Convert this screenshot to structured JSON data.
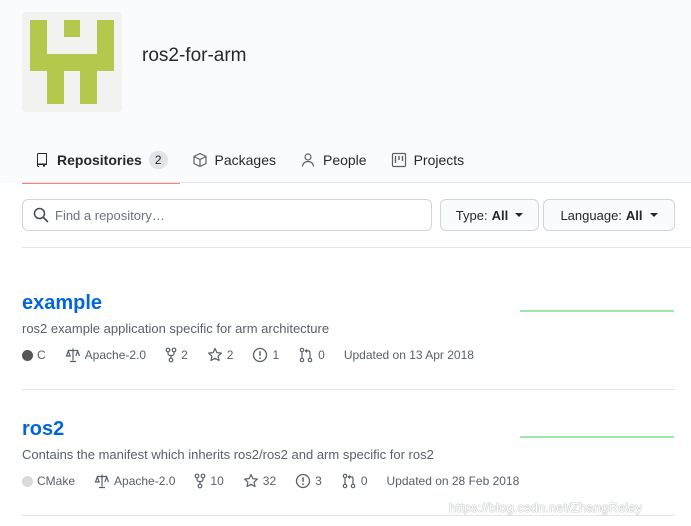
{
  "org": {
    "name": "ros2-for-arm",
    "avatar_color": "#b5c84e"
  },
  "tabs": [
    {
      "label": "Repositories",
      "count": "2",
      "icon": "repo-icon",
      "selected": true
    },
    {
      "label": "Packages",
      "icon": "package-icon"
    },
    {
      "label": "People",
      "icon": "person-icon"
    },
    {
      "label": "Projects",
      "icon": "project-icon"
    }
  ],
  "search": {
    "placeholder": "Find a repository…",
    "value": ""
  },
  "filters": {
    "type_label": "Type:",
    "type_value": "All",
    "language_label": "Language:",
    "language_value": "All"
  },
  "repos": [
    {
      "name": "example",
      "description": "ros2 example application specific for arm architecture",
      "language": "C",
      "language_color": "#555555",
      "license": "Apache-2.0",
      "forks": "2",
      "stars": "2",
      "issues": "1",
      "pull_requests": "0",
      "updated": "Updated on 13 Apr 2018"
    },
    {
      "name": "ros2",
      "description": "Contains the manifest which inherits ros2/ros2 and arm specific for ros2",
      "language": "CMake",
      "language_color": "#dadada",
      "license": "Apache-2.0",
      "forks": "10",
      "stars": "32",
      "issues": "3",
      "pull_requests": "0",
      "updated": "Updated on 28 Feb 2018"
    }
  ],
  "watermark": "https://blog.csdn.net/ZhangRelay",
  "colors": {
    "link": "#0366d6",
    "tab_underline": "#f9826c",
    "sparkline": "#9be9a8"
  }
}
